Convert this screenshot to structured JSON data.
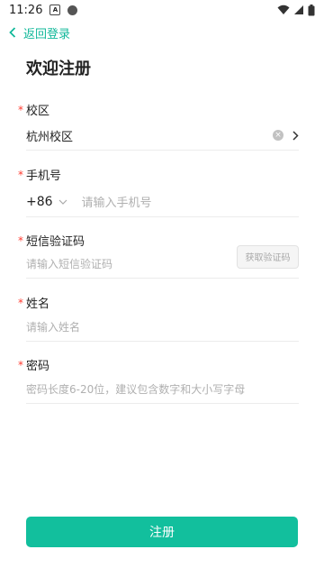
{
  "status_bar": {
    "time": "11:26"
  },
  "nav": {
    "back_label": "返回登录"
  },
  "page": {
    "title": "欢迎注册"
  },
  "form": {
    "required_mark": "*",
    "campus": {
      "label": "校区",
      "value": "杭州校区"
    },
    "phone": {
      "label": "手机号",
      "country_code": "+86",
      "placeholder": "请输入手机号"
    },
    "sms_code": {
      "label": "短信验证码",
      "placeholder": "请输入短信验证码",
      "button_label": "获取验证码"
    },
    "name": {
      "label": "姓名",
      "placeholder": "请输入姓名"
    },
    "password": {
      "label": "密码",
      "placeholder": "密码长度6-20位，建议包含数字和大小写字母"
    }
  },
  "submit": {
    "label": "注册"
  },
  "colors": {
    "accent": "#12bf9d",
    "required": "#ff3b30"
  }
}
